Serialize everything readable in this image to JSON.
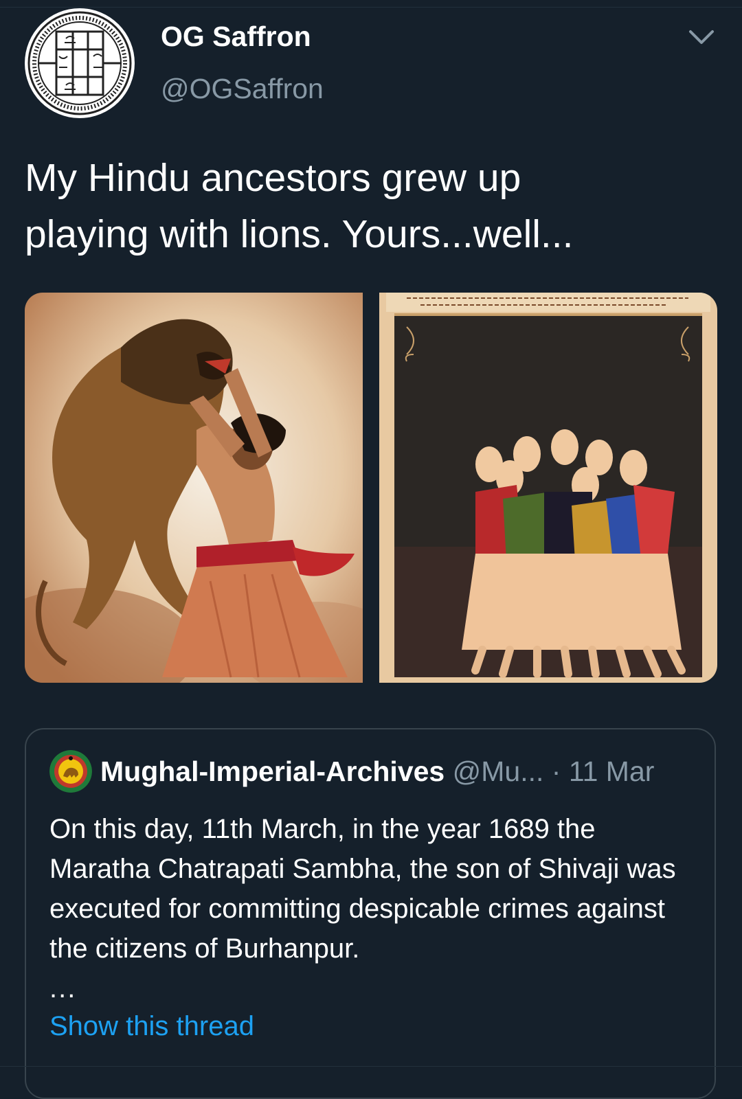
{
  "author": {
    "display_name": "OG Saffron",
    "handle": "@OGSaffron",
    "avatar_icon": "seal-emblem-icon"
  },
  "more_icon": "chevron-down-icon",
  "tweet": {
    "text": "My Hindu ancestors grew up\nplaying with lions. Yours...well..."
  },
  "media": [
    {
      "name": "painting-man-fighting-lion"
    },
    {
      "name": "miniature-painting-group-of-men"
    }
  ],
  "quoted_tweet": {
    "display_name": "Mughal-Imperial-Archives",
    "handle": "@Mu...",
    "separator": "·",
    "date": "11 Mar",
    "text": "On this day, 11th March, in the year 1689 the Maratha Chatrapati Sambha, the son of Shivaji was executed for committing despicable crimes against the citizens of Burhanpur.",
    "ellipsis": "...",
    "show_thread_label": "Show this thread",
    "avatar_icon": "lion-emblem-icon"
  },
  "colors": {
    "background": "#15202b",
    "secondary_text": "#8899a6",
    "link": "#1da1f2",
    "border": "#38444d"
  }
}
